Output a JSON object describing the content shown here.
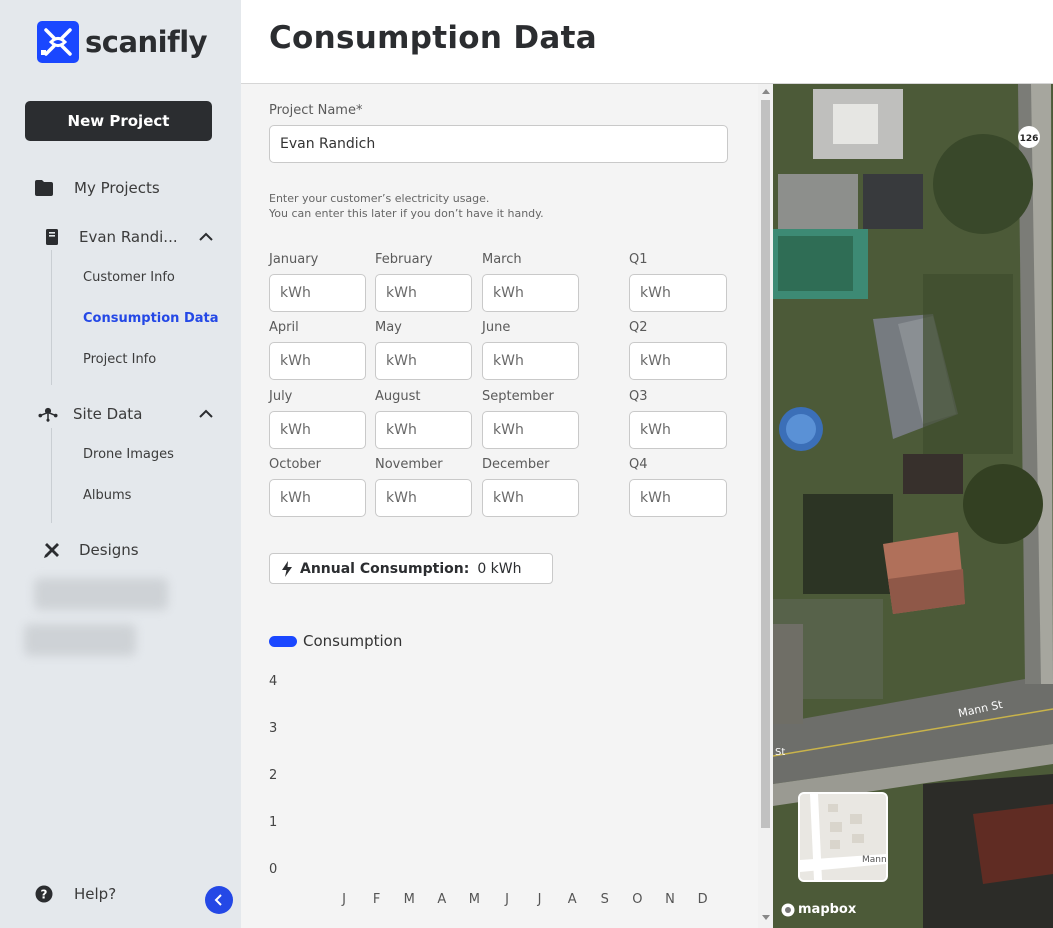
{
  "app": {
    "name": "scanifly",
    "brand_color": "#1a47ff"
  },
  "sidebar": {
    "new_project_label": "New Project",
    "my_projects_label": "My Projects",
    "project_label": "Evan Randi...",
    "project_subitems": [
      "Customer Info",
      "Consumption Data",
      "Project Info"
    ],
    "active_subitem": "Consumption Data",
    "site_data_label": "Site Data",
    "site_data_subitems": [
      "Drone Images",
      "Albums"
    ],
    "designs_label": "Designs",
    "help_label": "Help?",
    "icons": [
      "folder-icon",
      "document-icon",
      "drone-icon",
      "pencil-ruler-icon",
      "help-icon",
      "chevron-up-icon",
      "chevron-left-icon"
    ]
  },
  "header": {
    "title": "Consumption Data"
  },
  "form": {
    "project_name_label": "Project Name*",
    "project_name_value": "Evan Randich",
    "hint_line1": "Enter your customer’s electricity usage.",
    "hint_line2": "You can enter this later if you don’t have it handy.",
    "unit_placeholder": "kWh",
    "months": [
      "January",
      "February",
      "March",
      "April",
      "May",
      "June",
      "July",
      "August",
      "September",
      "October",
      "November",
      "December"
    ],
    "quarters": [
      "Q1",
      "Q2",
      "Q3",
      "Q4"
    ],
    "annual_label": "Annual Consumption:",
    "annual_value": "0 kWh"
  },
  "chart_data": {
    "type": "bar",
    "categories": [
      "J",
      "F",
      "M",
      "A",
      "M",
      "J",
      "J",
      "A",
      "S",
      "O",
      "N",
      "D"
    ],
    "series": [
      {
        "name": "Consumption",
        "values": [
          0,
          0,
          0,
          0,
          0,
          0,
          0,
          0,
          0,
          0,
          0,
          0
        ]
      }
    ],
    "y_ticks": [
      "4",
      "3",
      "2",
      "1",
      "0"
    ],
    "ylim": [
      0,
      4
    ],
    "color": "#1a47ff",
    "legend": "top-left"
  },
  "map": {
    "street_label": "Mann St",
    "street_label_short": "St",
    "route_badge": "126",
    "minimap_label": "Mann",
    "attribution": "mapbox"
  }
}
